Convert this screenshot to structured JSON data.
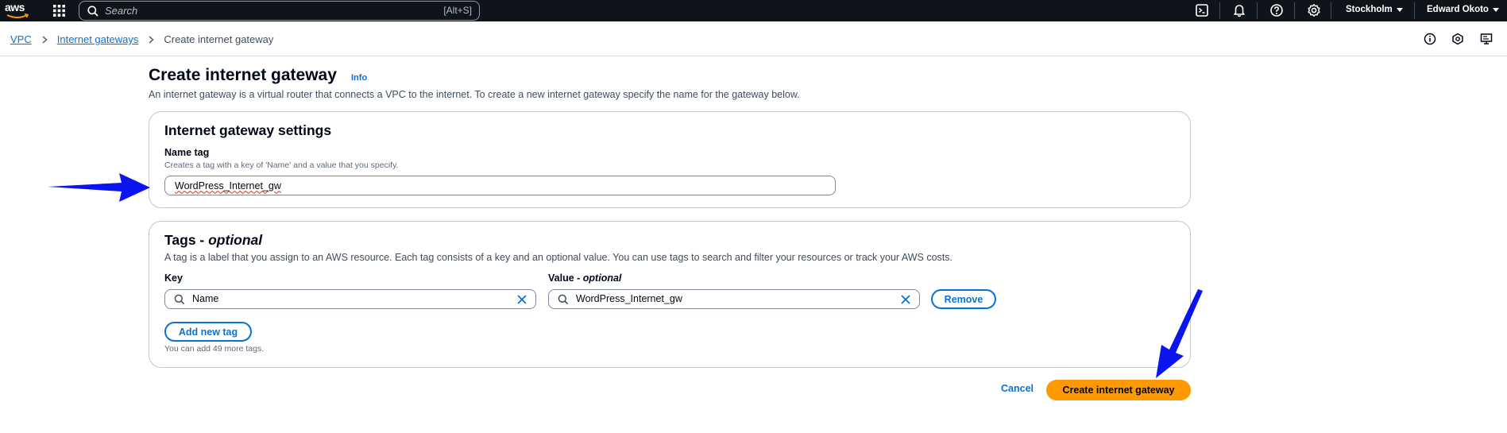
{
  "topnav": {
    "logo_text": "aws",
    "search": {
      "placeholder": "Search",
      "shortcut": "[Alt+S]"
    },
    "region": "Stockholm",
    "user": "Edward Okoto"
  },
  "breadcrumb": {
    "items": [
      "VPC",
      "Internet gateways"
    ],
    "current": "Create internet gateway"
  },
  "page": {
    "title": "Create internet gateway",
    "info_label": "Info",
    "description": "An internet gateway is a virtual router that connects a VPC to the internet. To create a new internet gateway specify the name for the gateway below."
  },
  "settings": {
    "title": "Internet gateway settings",
    "name_tag_label": "Name tag",
    "name_tag_desc": "Creates a tag with a key of 'Name' and a value that you specify.",
    "name_tag_value": "WordPress_Internet_gw"
  },
  "tags": {
    "title_main": "Tags - ",
    "title_optional": "optional",
    "description": "A tag is a label that you assign to an AWS resource. Each tag consists of a key and an optional value. You can use tags to search and filter your resources or track your AWS costs.",
    "key_label": "Key",
    "value_label_main": "Value - ",
    "value_label_optional": "optional",
    "rows": [
      {
        "key": "Name",
        "value": "WordPress_Internet_gw"
      }
    ],
    "remove_label": "Remove",
    "add_label": "Add new tag",
    "helper": "You can add 49 more tags."
  },
  "actions": {
    "cancel_label": "Cancel",
    "create_label": "Create internet gateway"
  },
  "colors": {
    "nav_bg": "#0f141a",
    "link": "#0972d3",
    "primary": "#ff9900",
    "annotation_arrow": "#0a14f0"
  },
  "icons": {
    "topnav": [
      "grid-icon",
      "search-icon",
      "cloudshell-icon",
      "bell-icon",
      "help-icon",
      "settings-icon"
    ],
    "crumbbar": [
      "info-icon",
      "feedback-icon",
      "display-icon"
    ]
  }
}
